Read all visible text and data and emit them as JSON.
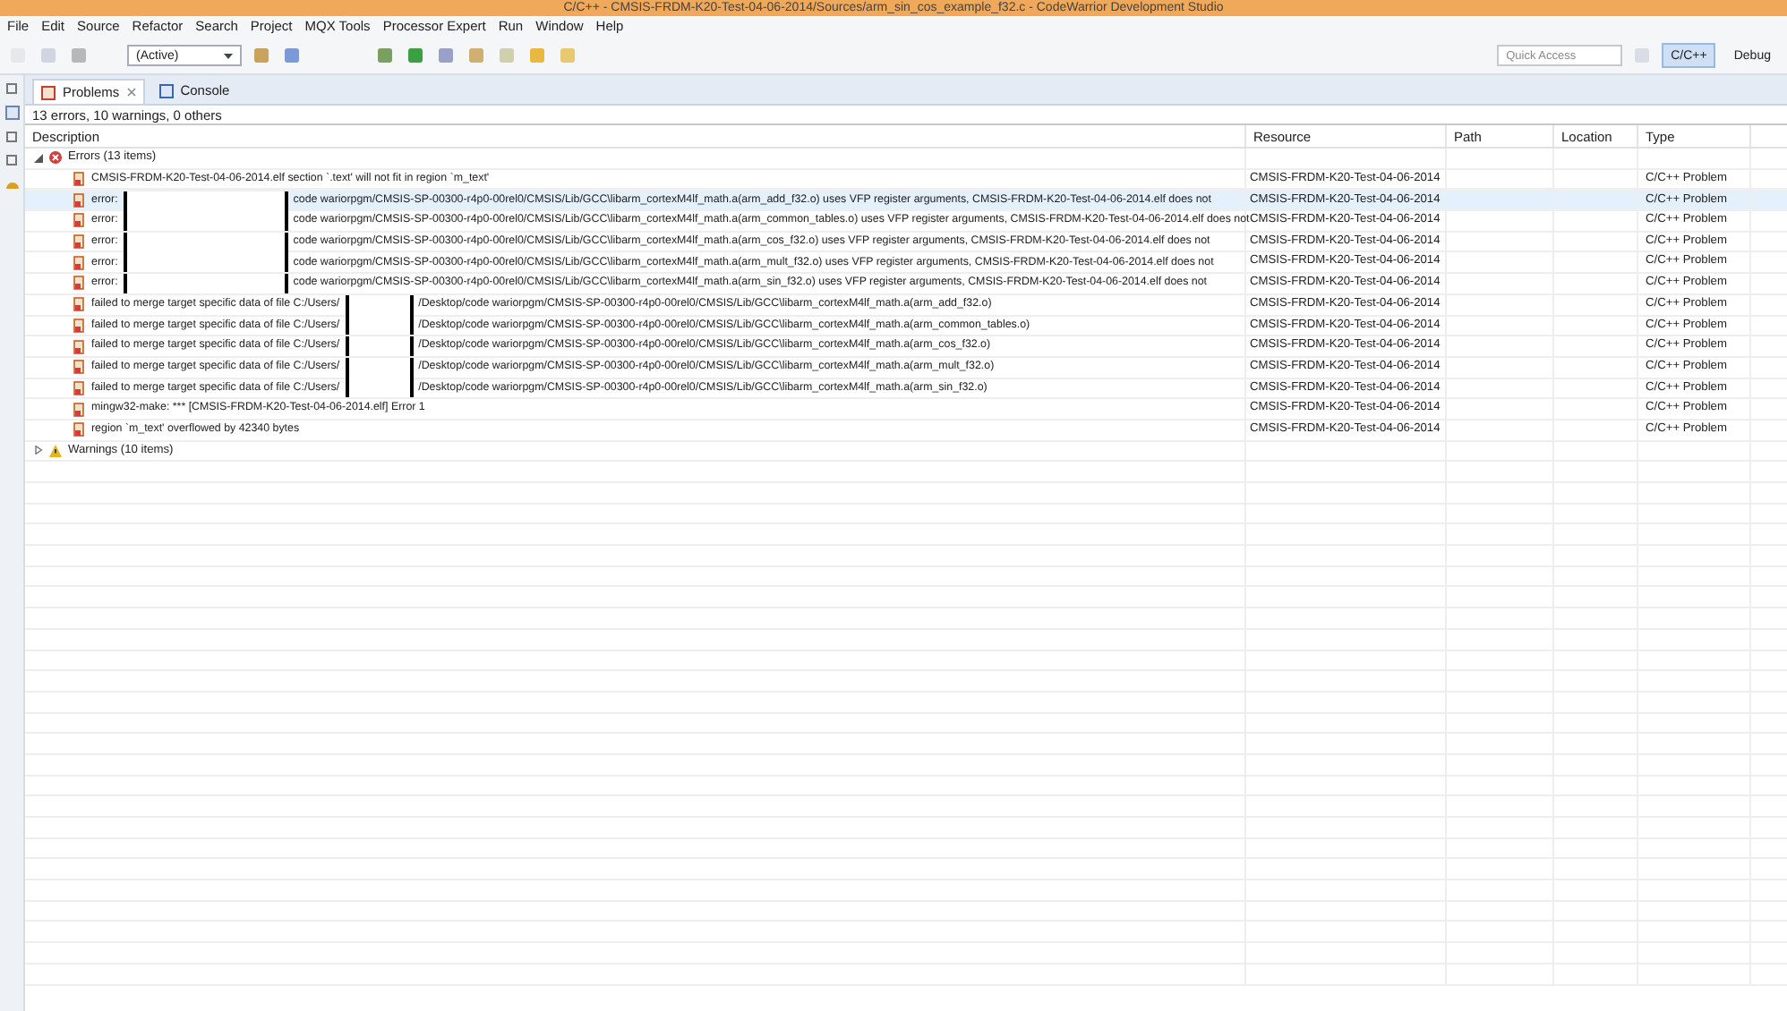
{
  "window": {
    "title": "C/C++ - CMSIS-FRDM-K20-Test-04-06-2014/Sources/arm_sin_cos_example_f32.c - CodeWarrior Development Studio"
  },
  "menu": [
    "File",
    "Edit",
    "Source",
    "Refactor",
    "Search",
    "Project",
    "MQX Tools",
    "Processor Expert",
    "Run",
    "Window",
    "Help"
  ],
  "toolbar": {
    "build_config": "(Active)",
    "quick_access": {
      "placeholder": "Quick Access"
    },
    "perspectives": [
      {
        "label": "C/C++",
        "selected": true
      },
      {
        "label": "Debug",
        "selected": false
      }
    ]
  },
  "tabs": [
    {
      "label": "Problems",
      "selected": true,
      "closable": true
    },
    {
      "label": "Console",
      "selected": false,
      "closable": false
    }
  ],
  "summary": "13 errors, 10 warnings, 0 others",
  "columns": [
    "Description",
    "Resource",
    "Path",
    "Location",
    "Type"
  ],
  "groups": [
    {
      "label": "Errors (13 items)",
      "kind": "error",
      "expanded": true,
      "children": [
        {
          "kind": "plain",
          "prefix": "CMSIS-FRDM-K20-Test-04-06-2014.elf section `.text' will not fit in region `m_text'",
          "resource": "CMSIS-FRDM-K20-Test-04-06-2014",
          "type": "C/C++ Problem",
          "selected": false
        },
        {
          "kind": "wide_redaction",
          "prefix": "error:",
          "text": "code wariorpgm/CMSIS-SP-00300-r4p0-00rel0/CMSIS/Lib/GCC\\libarm_cortexM4lf_math.a(arm_add_f32.o) uses VFP register arguments, CMSIS-FRDM-K20-Test-04-06-2014.elf does not",
          "resource": "CMSIS-FRDM-K20-Test-04-06-2014",
          "type": "C/C++ Problem",
          "selected": true
        },
        {
          "kind": "wide_redaction",
          "prefix": "error:",
          "text": "code wariorpgm/CMSIS-SP-00300-r4p0-00rel0/CMSIS/Lib/GCC\\libarm_cortexM4lf_math.a(arm_common_tables.o) uses VFP register arguments, CMSIS-FRDM-K20-Test-04-06-2014.elf does not",
          "resource": "CMSIS-FRDM-K20-Test-04-06-2014",
          "type": "C/C++ Problem",
          "selected": false
        },
        {
          "kind": "wide_redaction",
          "prefix": "error:",
          "text": "code wariorpgm/CMSIS-SP-00300-r4p0-00rel0/CMSIS/Lib/GCC\\libarm_cortexM4lf_math.a(arm_cos_f32.o) uses VFP register arguments, CMSIS-FRDM-K20-Test-04-06-2014.elf does not",
          "resource": "CMSIS-FRDM-K20-Test-04-06-2014",
          "type": "C/C++ Problem",
          "selected": false
        },
        {
          "kind": "wide_redaction",
          "prefix": "error:",
          "text": "code wariorpgm/CMSIS-SP-00300-r4p0-00rel0/CMSIS/Lib/GCC\\libarm_cortexM4lf_math.a(arm_mult_f32.o) uses VFP register arguments, CMSIS-FRDM-K20-Test-04-06-2014.elf does not",
          "resource": "CMSIS-FRDM-K20-Test-04-06-2014",
          "type": "C/C++ Problem",
          "selected": false
        },
        {
          "kind": "wide_redaction",
          "prefix": "error:",
          "text": "code wariorpgm/CMSIS-SP-00300-r4p0-00rel0/CMSIS/Lib/GCC\\libarm_cortexM4lf_math.a(arm_sin_f32.o) uses VFP register arguments, CMSIS-FRDM-K20-Test-04-06-2014.elf does not",
          "resource": "CMSIS-FRDM-K20-Test-04-06-2014",
          "type": "C/C++ Problem",
          "selected": false
        },
        {
          "kind": "narrow_redaction",
          "prefix": "failed to merge target specific data of file C:/Users/",
          "text": "/Desktop/code wariorpgm/CMSIS-SP-00300-r4p0-00rel0/CMSIS/Lib/GCC\\libarm_cortexM4lf_math.a(arm_add_f32.o)",
          "resource": "CMSIS-FRDM-K20-Test-04-06-2014",
          "type": "C/C++ Problem",
          "selected": false
        },
        {
          "kind": "narrow_redaction",
          "prefix": "failed to merge target specific data of file C:/Users/",
          "text": "/Desktop/code wariorpgm/CMSIS-SP-00300-r4p0-00rel0/CMSIS/Lib/GCC\\libarm_cortexM4lf_math.a(arm_common_tables.o)",
          "resource": "CMSIS-FRDM-K20-Test-04-06-2014",
          "type": "C/C++ Problem",
          "selected": false
        },
        {
          "kind": "narrow_redaction",
          "prefix": "failed to merge target specific data of file C:/Users/",
          "text": "/Desktop/code wariorpgm/CMSIS-SP-00300-r4p0-00rel0/CMSIS/Lib/GCC\\libarm_cortexM4lf_math.a(arm_cos_f32.o)",
          "resource": "CMSIS-FRDM-K20-Test-04-06-2014",
          "type": "C/C++ Problem",
          "selected": false
        },
        {
          "kind": "narrow_redaction",
          "prefix": "failed to merge target specific data of file C:/Users/",
          "text": "/Desktop/code wariorpgm/CMSIS-SP-00300-r4p0-00rel0/CMSIS/Lib/GCC\\libarm_cortexM4lf_math.a(arm_mult_f32.o)",
          "resource": "CMSIS-FRDM-K20-Test-04-06-2014",
          "type": "C/C++ Problem",
          "selected": false
        },
        {
          "kind": "narrow_redaction",
          "prefix": "failed to merge target specific data of file C:/Users/",
          "text": "/Desktop/code wariorpgm/CMSIS-SP-00300-r4p0-00rel0/CMSIS/Lib/GCC\\libarm_cortexM4lf_math.a(arm_sin_f32.o)",
          "resource": "CMSIS-FRDM-K20-Test-04-06-2014",
          "type": "C/C++ Problem",
          "selected": false
        },
        {
          "kind": "plain",
          "prefix": "mingw32-make: *** [CMSIS-FRDM-K20-Test-04-06-2014.elf] Error 1",
          "resource": "CMSIS-FRDM-K20-Test-04-06-2014",
          "type": "C/C++ Problem",
          "selected": false
        },
        {
          "kind": "plain",
          "prefix": "region `m_text' overflowed by 42340 bytes",
          "resource": "CMSIS-FRDM-K20-Test-04-06-2014",
          "type": "C/C++ Problem",
          "selected": false
        }
      ]
    },
    {
      "label": "Warnings (10 items)",
      "kind": "warning",
      "expanded": false
    }
  ]
}
